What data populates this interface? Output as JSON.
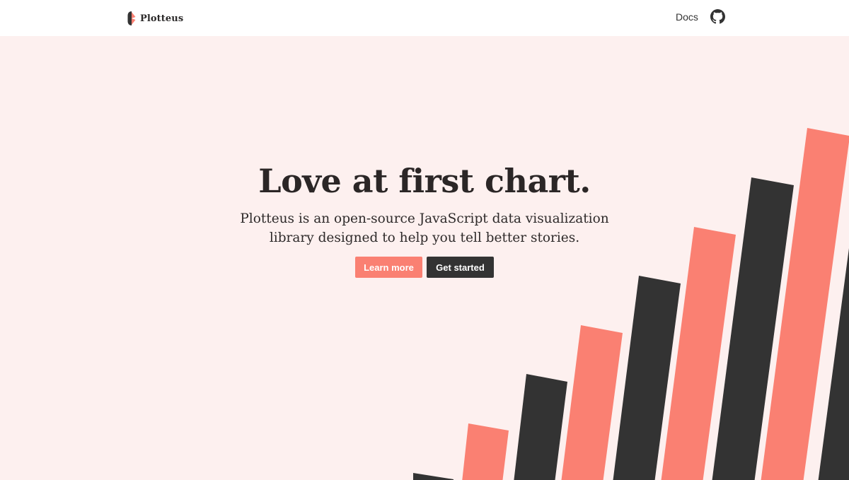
{
  "brand": {
    "name": "Plotteus"
  },
  "nav": {
    "docs_label": "Docs",
    "github_icon": "github-icon"
  },
  "hero": {
    "headline": "Love at first chart.",
    "subhead_line1": "Plotteus is an open-source JavaScript data visualization",
    "subhead_line2": "library designed to help you tell better stories.",
    "learn_more_label": "Learn more",
    "get_started_label": "Get started"
  },
  "colors": {
    "accent": "#fa8072",
    "dark": "#333333",
    "background": "#fdf0ef",
    "header": "#ffffff"
  }
}
